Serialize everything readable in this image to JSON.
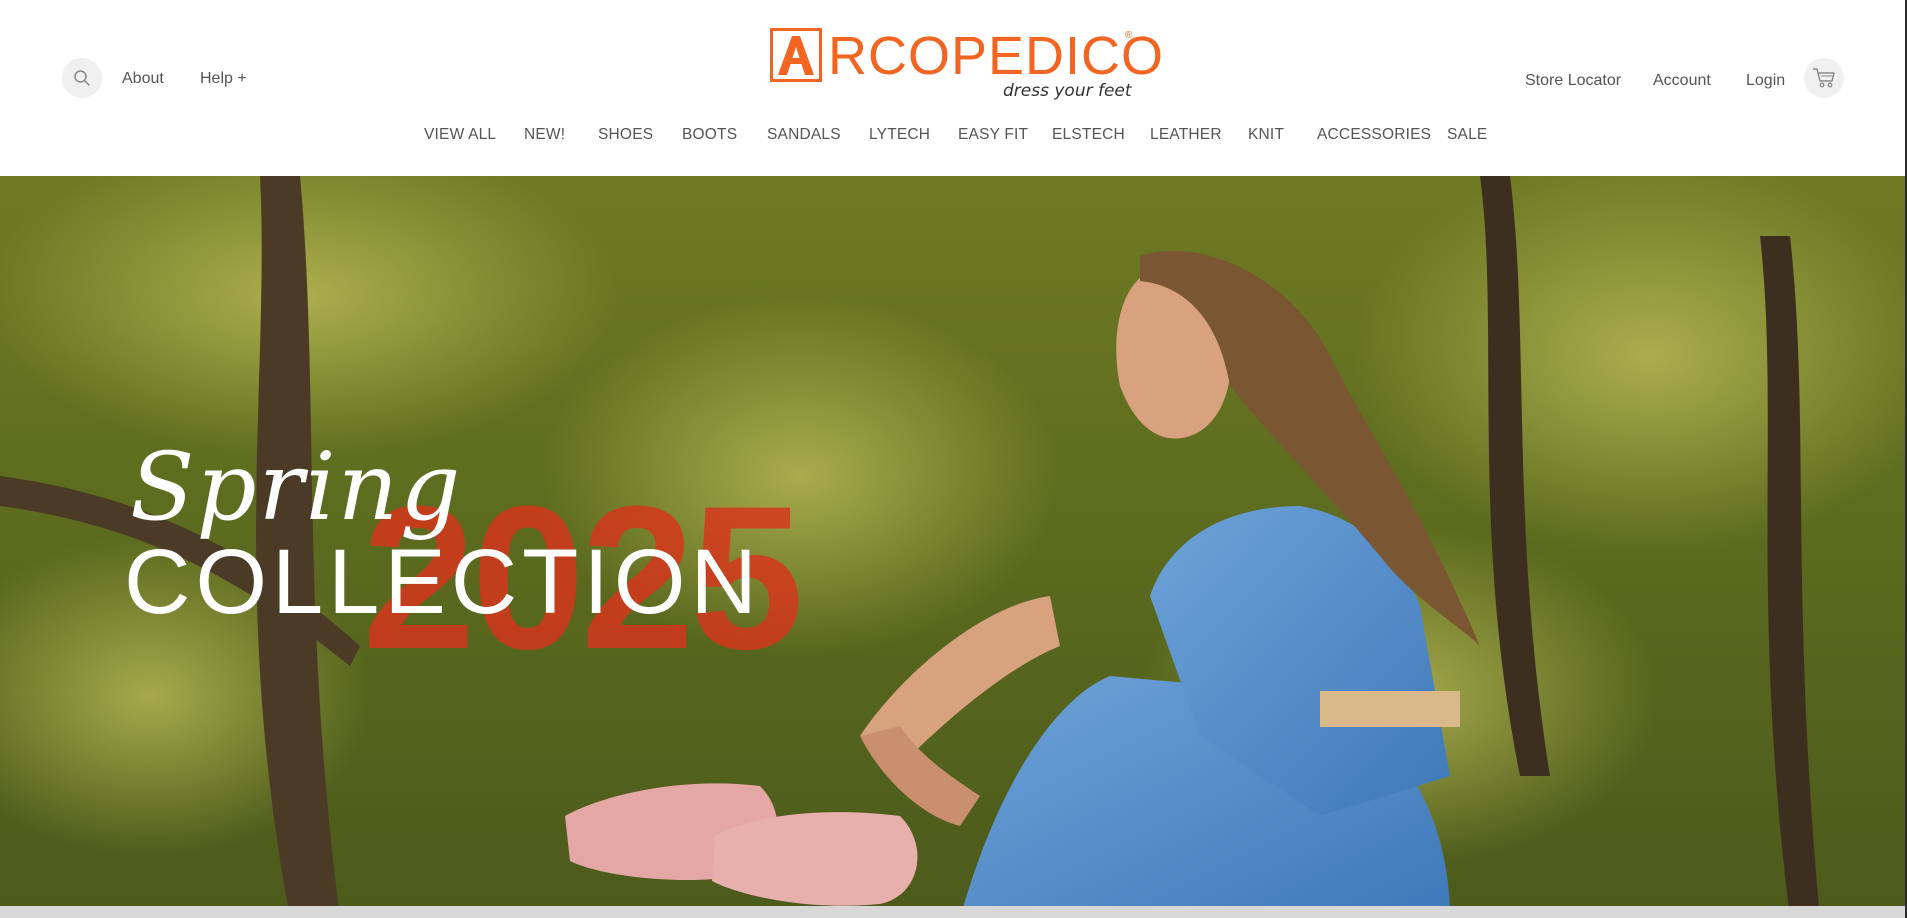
{
  "brand": {
    "name": "RCOPEDICO",
    "logo_letter": "A",
    "tagline": "dress your feet",
    "reg_mark": "®",
    "accent_color": "#f26522"
  },
  "top_left": {
    "search_icon": "search-icon",
    "about": "About",
    "help": "Help +"
  },
  "top_right": {
    "store_locator": "Store Locator",
    "account": "Account",
    "login": "Login",
    "cart_icon": "cart-icon"
  },
  "nav": [
    "VIEW ALL",
    "NEW!",
    "SHOES",
    "BOOTS",
    "SANDALS",
    "LYTECH",
    "EASY FIT",
    "ELSTECH",
    "LEATHER",
    "KNIT",
    "ACCESSORIES",
    "SALE"
  ],
  "hero": {
    "script_word": "Spring",
    "year": "2025",
    "headline": "COLLECTION",
    "year_color": "#d9341c"
  }
}
